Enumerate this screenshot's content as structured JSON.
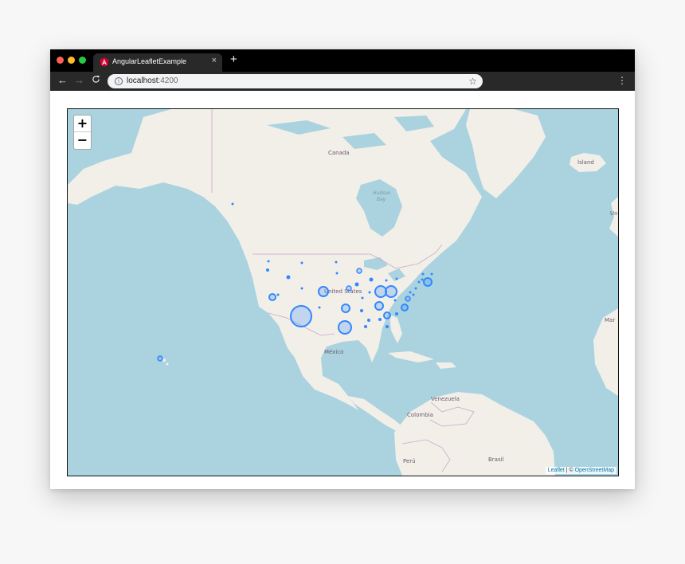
{
  "browser": {
    "tab_title": "AngularLeafletExample",
    "tab_close": "×",
    "new_tab": "+",
    "url_host": "localhost",
    "url_port": ":4200",
    "icons": [
      "angular-favicon-icon",
      "back-arrow-icon",
      "forward-arrow-icon",
      "reload-icon",
      "info-icon",
      "star-icon",
      "menu-dots-icon",
      "close-icon"
    ],
    "window_colors": {
      "close": "#fe5f57",
      "minimize": "#febc2e",
      "maximize": "#28c840"
    }
  },
  "map": {
    "zoom_in": "+",
    "zoom_out": "−",
    "attribution_leaflet": "Leaflet",
    "attribution_sep": " | © ",
    "attribution_osm": "OpenStreetMap",
    "labels": {
      "canada": "Canada",
      "hudson": "Hudson",
      "bay": "Bay",
      "united_states": "United States",
      "mexico": "México",
      "venezuela": "Venezuela",
      "colombia": "Colombia",
      "peru": "Perú",
      "brasil": "Brasil",
      "island": "Ísland",
      "un": "Un",
      "mar": "Mar"
    },
    "marker_color": "#3388ff",
    "ocean_color": "#aad3df",
    "land_color": "#f2efe9"
  }
}
